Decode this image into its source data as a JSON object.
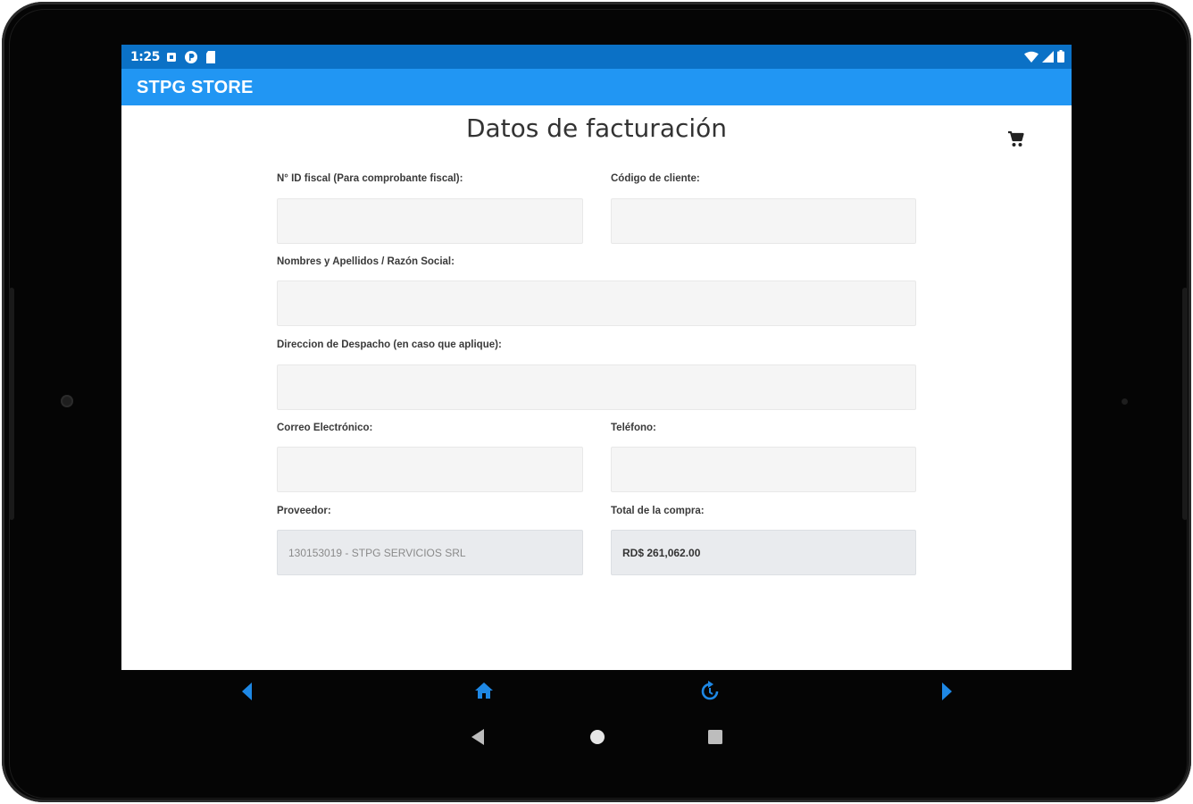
{
  "status_bar": {
    "time": "1:25",
    "left_icons": [
      "notification-square-icon",
      "app-logo-icon",
      "sd-card-icon"
    ],
    "right_icons": [
      "wifi-icon",
      "cell-signal-icon",
      "battery-icon"
    ]
  },
  "app_bar": {
    "title": "STPG STORE"
  },
  "page": {
    "title": "Datos de facturación",
    "cart_icon": "cart-icon"
  },
  "form": {
    "fiscal_id": {
      "label": "N° ID fiscal (Para comprobante fiscal):",
      "value": ""
    },
    "client_code": {
      "label": "Código de cliente:",
      "value": ""
    },
    "full_name": {
      "label": "Nombres y Apellidos / Razón Social:",
      "value": ""
    },
    "dispatch_address": {
      "label": "Direccion de Despacho (en caso que aplique):",
      "value": ""
    },
    "email": {
      "label": "Correo Electrónico:",
      "value": ""
    },
    "phone": {
      "label": "Teléfono:",
      "value": ""
    },
    "provider": {
      "label": "Proveedor:",
      "value": "130153019 - STPG SERVICIOS SRL"
    },
    "total": {
      "label": "Total de la compra:",
      "value": "RD$ 261,062.00"
    }
  },
  "bottom_nav": {
    "items": [
      "back-icon",
      "home-icon",
      "refresh-icon",
      "forward-icon"
    ],
    "accent_color": "#1e88e5"
  },
  "system_nav": [
    "back-triangle-icon",
    "home-circle-icon",
    "recents-square-icon"
  ],
  "colors": {
    "status_bar": "#0b71c6",
    "app_bar": "#2196f3",
    "input_bg": "#f5f5f5",
    "readonly_bg": "#e9ebee"
  }
}
